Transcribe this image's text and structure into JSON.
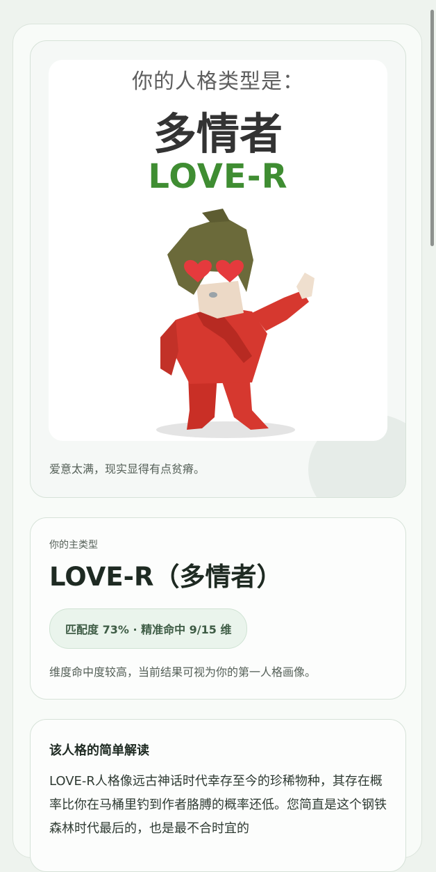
{
  "hero": {
    "label": "你的人格类型是：",
    "name": "多情者",
    "code": "LOVE-R",
    "caption": "爱意太满，现实显得有点贫瘠。"
  },
  "main_type": {
    "label": "你的主类型",
    "title": "LOVE-R（多情者）",
    "match_badge": "匹配度 73% · 精准命中 9/15 维",
    "description": "维度命中度较高，当前结果可视为你的第一人格画像。"
  },
  "interpretation": {
    "heading": "该人格的简单解读",
    "body": "LOVE-R人格像远古神话时代幸存至今的珍稀物种，其存在概率比你在马桶里钓到作者胳膊的概率还低。您简直是这个钢铁森林时代最后的，也是最不合时宜的"
  },
  "colors": {
    "accent_green": "#3f8d32",
    "character_red": "#d6382f",
    "character_hair": "#6b6a3a",
    "heart_red": "#e53a3d"
  }
}
